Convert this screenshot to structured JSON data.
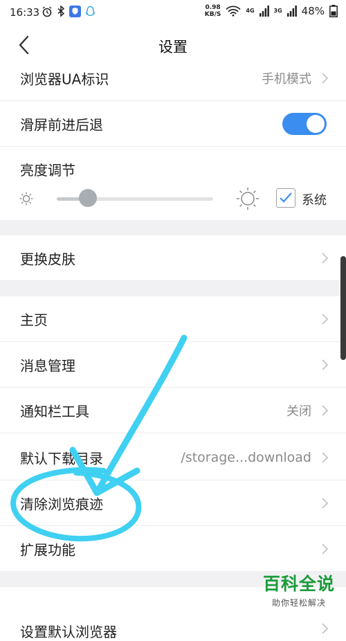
{
  "status_bar": {
    "time": "16:33",
    "net_speed_value": "0.98",
    "net_speed_unit": "KB/S",
    "net_4g": "4G",
    "net_3g": "3G",
    "battery": "48%"
  },
  "header": {
    "title": "设置"
  },
  "rows": {
    "ua": {
      "label": "浏览器UA标识",
      "value": "手机模式"
    },
    "swipe": {
      "label": "滑屏前进后退",
      "enabled": true
    },
    "brightness": {
      "label": "亮度调节",
      "level": 0.2,
      "system_checked": true,
      "system_label": "系统"
    },
    "skin": {
      "label": "更换皮肤"
    },
    "home": {
      "label": "主页"
    },
    "messages": {
      "label": "消息管理"
    },
    "notif": {
      "label": "通知栏工具",
      "value": "关闭"
    },
    "download": {
      "label": "默认下载目录",
      "value": "/storage...download"
    },
    "clear": {
      "label": "清除浏览痕迹"
    },
    "extend": {
      "label": "扩展功能"
    },
    "default_browser": {
      "label": "设置默认浏览器"
    }
  },
  "watermark": {
    "main": "百科全说",
    "sub": "助你轻松解决"
  },
  "colors": {
    "accent": "#3b8df0",
    "annotation": "#3fd0f2",
    "watermark": "#1a9b3a"
  }
}
